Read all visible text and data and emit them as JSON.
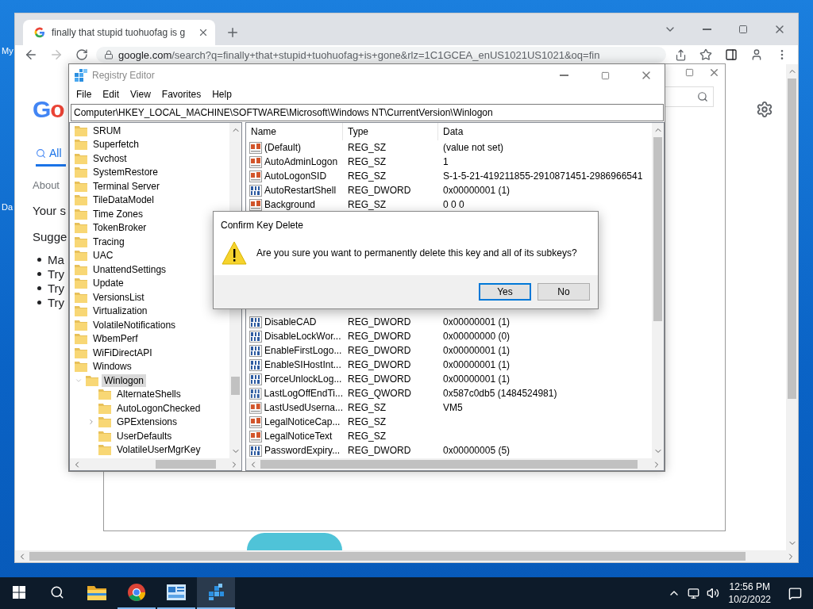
{
  "desktop": {
    "icons": [
      {
        "label": "My"
      },
      {
        "label": "Da"
      }
    ]
  },
  "browser": {
    "tab": {
      "title": "finally that stupid tuohuofag is g",
      "selected": true
    },
    "nav": {
      "back_disabled": false,
      "forward_disabled": true
    },
    "address": {
      "host": "google.com",
      "path": "/search?q=finally+that+stupid+tuohuofag+is+gone&rlz=1C1GCEA_enUS1021US1021&oq=fin"
    },
    "page": {
      "logo": "Go",
      "tab": {
        "label": "All",
        "selected": true
      },
      "about": "About",
      "lines": [
        "Your s",
        "Sugge"
      ],
      "bullets": [
        "Ma",
        "Try",
        "Try",
        "Try"
      ]
    }
  },
  "registry_editor": {
    "title": "Registry Editor",
    "menu": [
      "File",
      "Edit",
      "View",
      "Favorites",
      "Help"
    ],
    "address": "Computer\\HKEY_LOCAL_MACHINE\\SOFTWARE\\Microsoft\\Windows NT\\CurrentVersion\\Winlogon",
    "tree": [
      {
        "label": "SRUM",
        "selected": false
      },
      {
        "label": "Superfetch",
        "selected": false
      },
      {
        "label": "Svchost",
        "selected": false
      },
      {
        "label": "SystemRestore",
        "selected": false
      },
      {
        "label": "Terminal Server",
        "selected": false
      },
      {
        "label": "TileDataModel",
        "selected": false
      },
      {
        "label": "Time Zones",
        "selected": false
      },
      {
        "label": "TokenBroker",
        "selected": false
      },
      {
        "label": "Tracing",
        "selected": false
      },
      {
        "label": "UAC",
        "selected": false
      },
      {
        "label": "UnattendSettings",
        "selected": false
      },
      {
        "label": "Update",
        "selected": false
      },
      {
        "label": "VersionsList",
        "selected": false
      },
      {
        "label": "Virtualization",
        "selected": false
      },
      {
        "label": "VolatileNotifications",
        "selected": false
      },
      {
        "label": "WbemPerf",
        "selected": false
      },
      {
        "label": "WiFiDirectAPI",
        "selected": false
      },
      {
        "label": "Windows",
        "selected": false
      },
      {
        "label": "Winlogon",
        "selected": true,
        "expanded": true,
        "children": [
          {
            "label": "AlternateShells",
            "selected": false
          },
          {
            "label": "AutoLogonChecked",
            "selected": false
          },
          {
            "label": "GPExtensions",
            "selected": false,
            "expanded": false
          },
          {
            "label": "UserDefaults",
            "selected": false
          },
          {
            "label": "VolatileUserMgrKey",
            "selected": false
          }
        ]
      }
    ],
    "table": {
      "columns": [
        "Name",
        "Type",
        "Data"
      ],
      "rows_top": [
        {
          "kind": "string",
          "name": "(Default)",
          "type": "REG_SZ",
          "data": "(value not set)"
        },
        {
          "kind": "string",
          "name": "AutoAdminLogon",
          "type": "REG_SZ",
          "data": "1"
        },
        {
          "kind": "string",
          "name": "AutoLogonSID",
          "type": "REG_SZ",
          "data": "S-1-5-21-419211855-2910871451-2986966541"
        },
        {
          "kind": "binary",
          "name": "AutoRestartShell",
          "type": "REG_DWORD",
          "data": "0x00000001 (1)"
        },
        {
          "kind": "string",
          "name": "Background",
          "type": "REG_SZ",
          "data": "0 0 0"
        }
      ],
      "rows_bottom": [
        {
          "kind": "binary",
          "name": "DisableCAD",
          "type": "REG_DWORD",
          "data": "0x00000001 (1)"
        },
        {
          "kind": "binary",
          "name": "DisableLockWor...",
          "type": "REG_DWORD",
          "data": "0x00000000 (0)"
        },
        {
          "kind": "binary",
          "name": "EnableFirstLogo...",
          "type": "REG_DWORD",
          "data": "0x00000001 (1)"
        },
        {
          "kind": "binary",
          "name": "EnableSIHostInt...",
          "type": "REG_DWORD",
          "data": "0x00000001 (1)"
        },
        {
          "kind": "binary",
          "name": "ForceUnlockLog...",
          "type": "REG_DWORD",
          "data": "0x00000001 (1)"
        },
        {
          "kind": "binary",
          "name": "LastLogOffEndTi...",
          "type": "REG_QWORD",
          "data": "0x587c0db5 (1484524981)"
        },
        {
          "kind": "string",
          "name": "LastUsedUserna...",
          "type": "REG_SZ",
          "data": "VM5"
        },
        {
          "kind": "string",
          "name": "LegalNoticeCap...",
          "type": "REG_SZ"
        },
        {
          "kind": "string",
          "name": "LegalNoticeText",
          "type": "REG_SZ"
        },
        {
          "kind": "binary",
          "name": "PasswordExpiry...",
          "type": "REG_DWORD",
          "data": "0x00000005 (5)"
        }
      ]
    }
  },
  "dialog": {
    "title": "Confirm Key Delete",
    "message": "Are you sure you want to permanently delete this key and all of its subkeys?",
    "buttons": [
      {
        "label": "Yes",
        "default": true
      },
      {
        "label": "No",
        "default": false
      }
    ]
  },
  "taskbar": {
    "apps": [
      {
        "kind": "explorer",
        "running": false,
        "selected": false
      },
      {
        "kind": "chrome",
        "running": true,
        "selected": false
      },
      {
        "kind": "control",
        "running": true,
        "selected": false
      },
      {
        "kind": "regedit",
        "running": true,
        "selected": true
      }
    ],
    "clock": {
      "time": "12:56 PM",
      "date": "10/2/2022"
    }
  }
}
